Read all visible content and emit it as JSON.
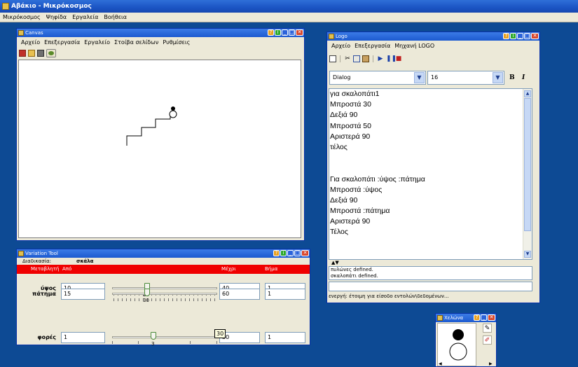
{
  "app": {
    "title": "Αβάκιο - Μικρόκοσμος",
    "menu": [
      "Μικρόκοσμος",
      "Ψηφίδα",
      "Εργαλεία",
      "Βοήθεια"
    ]
  },
  "canvas_window": {
    "title": "Canvas",
    "menu": [
      "Αρχείο",
      "Επεξεργασία",
      "Εργαλείο",
      "Στοίβα σελίδων",
      "Ρυθμίσεις"
    ],
    "toolbar_icons": [
      "new-page-icon",
      "open-folder-icon",
      "print-icon",
      "turtle-icon"
    ]
  },
  "logo_window": {
    "title": "Logo",
    "menu": [
      "Αρχείο",
      "Επεξεργασία",
      "Μηχανή LOGO"
    ],
    "toolbar_icons": [
      "new-file-icon",
      "cut-icon",
      "copy-icon",
      "paste-icon",
      "run-icon",
      "pause-icon",
      "stop-icon"
    ],
    "font_name": "Dialog",
    "font_size": "16",
    "bold_label": "B",
    "italic_label": "I",
    "code_lines": [
      "για σκαλοπάτι1",
      "Μπροστά 30",
      "Δεξιά 90",
      " Μπροστά 50",
      "Αριστερά 90",
      " τέλος",
      "",
      "",
      "Για σκαλοπάτι  :ύψος :πάτημα",
      "Μπροστά :ύψος",
      " Δεξιά 90",
      " Μπροστά :πάτημα",
      "Αριστερά 90",
      "Τέλος"
    ],
    "messages": [
      "πυλώνες defined.",
      "σκαλοπάτι defined."
    ],
    "status": "ενεργή: έτοιμη για είσοδο εντολών\\δεδομένων..."
  },
  "variation_tool": {
    "title": "Variation Tool",
    "procedure_label": "Διαδικασία:",
    "procedure_name": "σκάλα",
    "headers": {
      "variable": "Μεταβλητή",
      "from": "Από",
      "to": "Μέχρι",
      "step": "Βήμα"
    },
    "rows": [
      {
        "name": "ύψος",
        "from": "10",
        "to": "40",
        "step": "1",
        "value": "20",
        "fraction": 0.33
      },
      {
        "name": "πάτημα",
        "from": "15",
        "to": "60",
        "step": "1",
        "value": "30",
        "fraction": 0.33
      },
      {
        "name": "φορές",
        "from": "1",
        "to": "30",
        "step": "1",
        "value": "3",
        "fraction": 0.45
      }
    ],
    "tooltip": "30"
  },
  "turtle_window": {
    "title": "Χελώνα"
  }
}
